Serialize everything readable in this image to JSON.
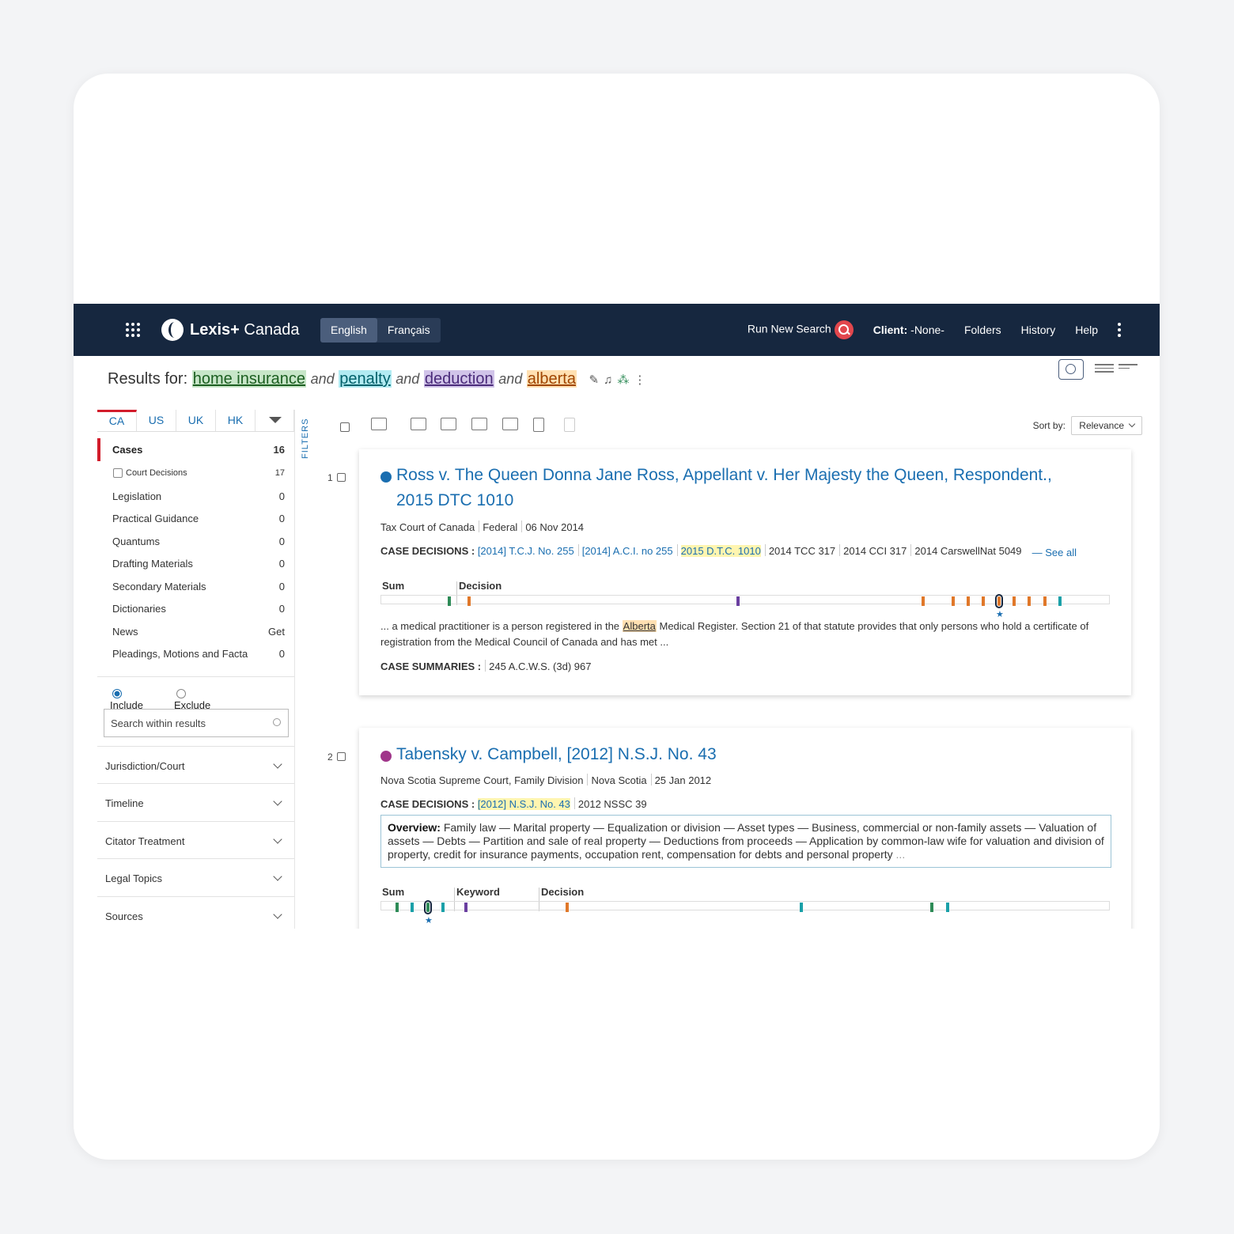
{
  "header": {
    "brand": "Lexis+",
    "brand_suffix": "Canada",
    "languages": [
      "English",
      "Français"
    ],
    "run_new_search": "Run New Search",
    "client_label": "Client:",
    "client_value": "-None-",
    "folders": "Folders",
    "history": "History",
    "help": "Help"
  },
  "results_for": {
    "prefix": "Results for:",
    "terms": [
      "home insurance",
      "penalty",
      "deduction",
      "alberta"
    ],
    "operator": "and"
  },
  "sidebar": {
    "tabs": [
      "CA",
      "US",
      "UK",
      "HK"
    ],
    "categories": [
      {
        "label": "Cases",
        "count": "16"
      },
      {
        "label": "Court Decisions",
        "count": "17"
      },
      {
        "label": "Legislation",
        "count": "0"
      },
      {
        "label": "Practical Guidance",
        "count": "0"
      },
      {
        "label": "Quantums",
        "count": "0"
      },
      {
        "label": "Drafting Materials",
        "count": "0"
      },
      {
        "label": "Secondary Materials",
        "count": "0"
      },
      {
        "label": "Dictionaries",
        "count": "0"
      },
      {
        "label": "News",
        "count": "Get"
      },
      {
        "label": "Pleadings, Motions and Facta",
        "count": "0"
      }
    ],
    "include": "Include",
    "exclude": "Exclude",
    "search_within": "Search within results",
    "facets": [
      "Jurisdiction/Court",
      "Timeline",
      "Citator Treatment",
      "Legal Topics",
      "Sources"
    ]
  },
  "filters_label": "FILTERS",
  "toolbar": {
    "sort_label": "Sort by:",
    "sort_value": "Relevance"
  },
  "results": [
    {
      "num": "1",
      "title": "Ross v. The Queen Donna Jane Ross, Appellant v. Her Majesty the Queen, Respondent., 2015 DTC 1010",
      "court": "Tax Court of Canada",
      "jurisdiction": "Federal",
      "date": "06 Nov 2014",
      "decisions_label": "CASE DECISIONS :",
      "citations": [
        "[2014] T.C.J. No. 255",
        "[2014] A.C.I. no 255",
        "2015 D.T.C. 1010",
        "2014 TCC 317",
        "2014 CCI 317",
        "2014 CarswellNat 5049"
      ],
      "see_all": "— See all",
      "hitmap_labels": [
        "Sum",
        "Decision"
      ],
      "snippet_pre": "... a medical practitioner is a person registered in the",
      "snippet_hl": "Alberta",
      "snippet_post": "Medical Register. Section 21 of that statute provides that only persons who hold a certificate of registration from the Medical Council of Canada and has met ...",
      "summaries_label": "CASE SUMMARIES :",
      "summary_cite": "245 A.C.W.S. (3d) 967"
    },
    {
      "num": "2",
      "title": "Tabensky v. Campbell, [2012] N.S.J. No. 43",
      "court": "Nova Scotia Supreme Court, Family Division",
      "jurisdiction": "Nova Scotia",
      "date": "25 Jan 2012",
      "decisions_label": "CASE DECISIONS :",
      "citations": [
        "[2012] N.S.J. No. 43",
        "2012 NSSC 39"
      ],
      "overview_label": "Overview:",
      "overview_text": "Family law — Marital property — Equalization or division — Asset types — Business, commercial or non-family assets — Valuation of assets — Debts — Partition and sale of real property — Deductions from proceeds — Application by common-law wife for valuation and division of property, credit for insurance payments, occupation rent, compensation for debts and personal property",
      "overview_ellipsis": "...",
      "hitmap_labels": [
        "Sum",
        "Keyword",
        "Decision"
      ]
    }
  ],
  "colors": {
    "header_bg": "#16273f",
    "accent_red": "#d21c2b",
    "link_blue": "#1a6eb0",
    "hit_green": "#2e8b57",
    "hit_teal": "#1aa0a8",
    "hit_purple": "#6a3fa0",
    "hit_orange": "#e0782a"
  }
}
